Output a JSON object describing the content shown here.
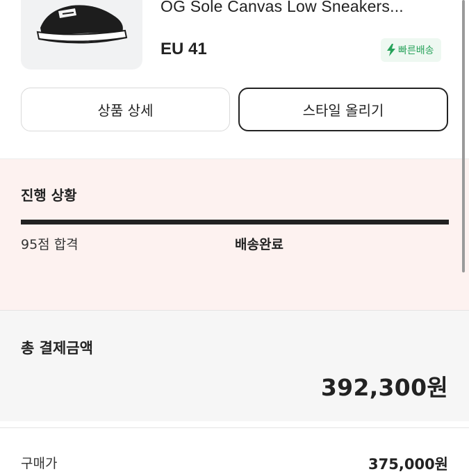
{
  "product": {
    "name": "OG Sole Canvas Low Sneakers...",
    "size": "EU 41",
    "badge": "빠른배송",
    "thumbnail_icon": "sneaker-image"
  },
  "actions": {
    "detail_label": "상품 상세",
    "style_label": "스타일 올리기"
  },
  "progress": {
    "title": "진행 상황",
    "grade": "95점 합격",
    "stage": "배송완료",
    "value": 1.0
  },
  "payment": {
    "title": "총 결제금액",
    "total": "392,300원"
  },
  "price": {
    "label": "구매가",
    "value": "375,000원"
  },
  "colors": {
    "accent_green": "#27a25a",
    "progress_bg": "#fdf2f0",
    "payment_bg": "#f6f6f6",
    "text": "#222222"
  }
}
